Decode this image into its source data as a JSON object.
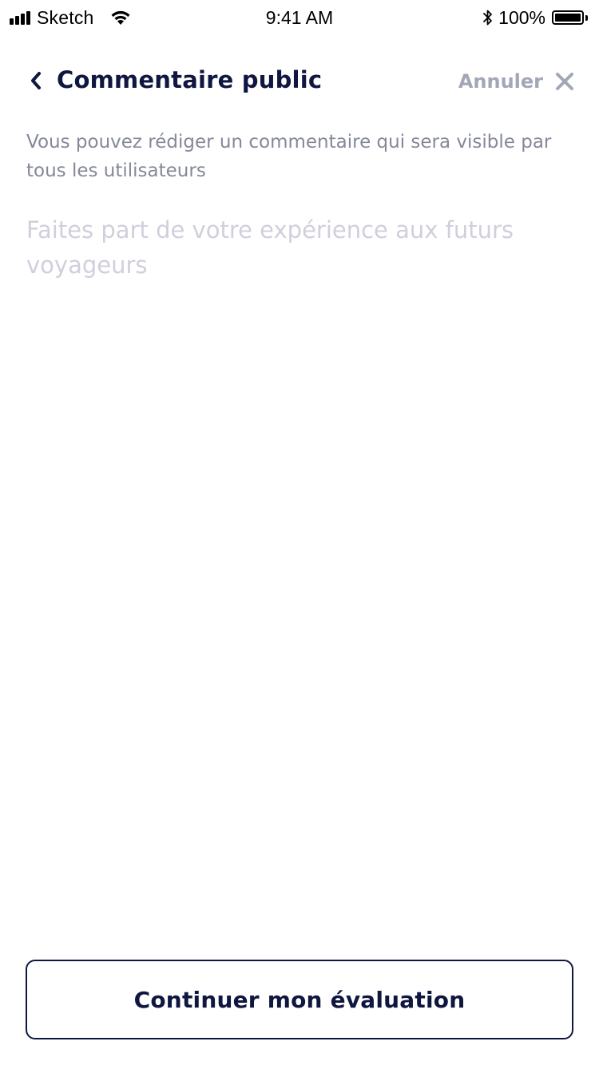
{
  "status_bar": {
    "carrier": "Sketch",
    "time": "9:41 AM",
    "battery_percent": "100%",
    "battery_level": 1.0,
    "icons": {
      "signal": "signal-bars-icon",
      "wifi": "wifi-icon",
      "bluetooth": "bluetooth-icon",
      "battery": "battery-icon"
    }
  },
  "header": {
    "back_icon": "chevron-left-icon",
    "title": "Commentaire public",
    "cancel_label": "Annuler",
    "close_icon": "close-icon"
  },
  "content": {
    "description": "Vous pouvez rédiger un commentaire qui sera visible par tous les utilisateurs",
    "comment": {
      "value": "",
      "placeholder": "Faites part de votre expérience aux futurs voyageurs"
    }
  },
  "footer": {
    "continue_label": "Continuer mon évaluation"
  },
  "colors": {
    "primary": "#0f1640",
    "muted_text": "#858899",
    "placeholder": "#cfd0dc",
    "cancel": "#a3a6b6",
    "background": "#ffffff"
  }
}
